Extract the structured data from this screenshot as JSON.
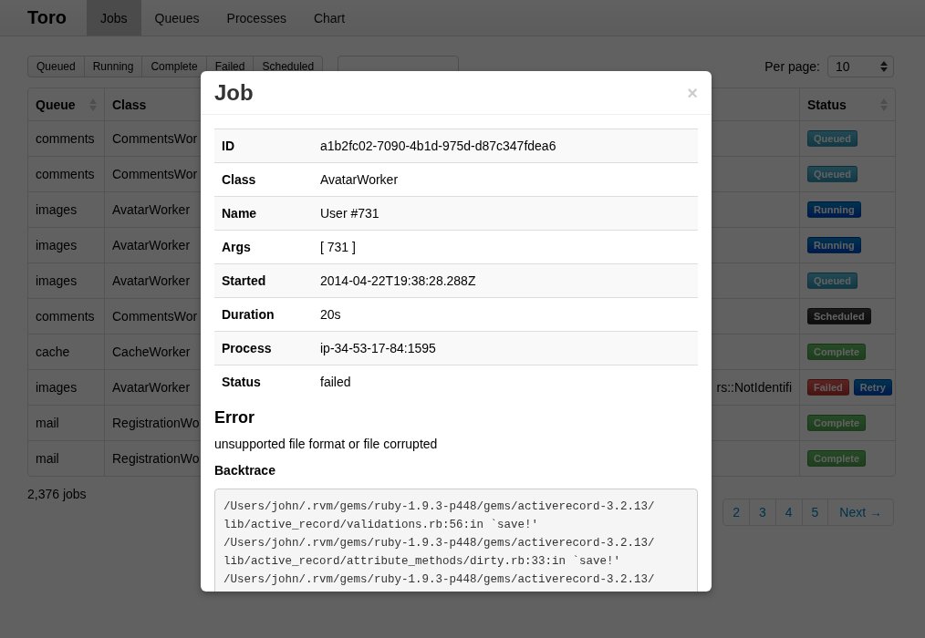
{
  "navbar": {
    "brand": "Toro",
    "tabs": [
      {
        "label": "Jobs",
        "selected": true
      },
      {
        "label": "Queues",
        "selected": false
      },
      {
        "label": "Processes",
        "selected": false
      },
      {
        "label": "Chart",
        "selected": false
      }
    ]
  },
  "filters": [
    "Queued",
    "Running",
    "Complete",
    "Failed",
    "Scheduled"
  ],
  "per_page": {
    "label": "Per page:",
    "value": "10"
  },
  "table": {
    "columns": [
      {
        "label": "Queue",
        "sortable": true
      },
      {
        "label": "Class"
      },
      {
        "label": "Status",
        "sortable": true
      }
    ],
    "rows": [
      {
        "queue": "comments",
        "class": "CommentsWor",
        "buttons": [
          {
            "label": "Queued",
            "kind": "queued"
          }
        ]
      },
      {
        "queue": "comments",
        "class": "CommentsWor",
        "buttons": [
          {
            "label": "Queued",
            "kind": "queued"
          }
        ]
      },
      {
        "queue": "images",
        "class": "AvatarWorker",
        "buttons": [
          {
            "label": "Running",
            "kind": "running"
          }
        ]
      },
      {
        "queue": "images",
        "class": "AvatarWorker",
        "buttons": [
          {
            "label": "Running",
            "kind": "running"
          }
        ]
      },
      {
        "queue": "images",
        "class": "AvatarWorker",
        "buttons": [
          {
            "label": "Queued",
            "kind": "queued"
          }
        ]
      },
      {
        "queue": "comments",
        "class": "CommentsWor",
        "buttons": [
          {
            "label": "Scheduled",
            "kind": "scheduled"
          }
        ]
      },
      {
        "queue": "cache",
        "class": "CacheWorker",
        "buttons": [
          {
            "label": "Complete",
            "kind": "complete"
          }
        ]
      },
      {
        "queue": "images",
        "class": "AvatarWorker",
        "error": "rs::NotIdentifi",
        "buttons": [
          {
            "label": "Failed",
            "kind": "failed"
          },
          {
            "label": "Retry",
            "kind": "retry"
          }
        ]
      },
      {
        "queue": "mail",
        "class": "RegistrationWo",
        "buttons": [
          {
            "label": "Complete",
            "kind": "complete"
          }
        ]
      },
      {
        "queue": "mail",
        "class": "RegistrationWo",
        "buttons": [
          {
            "label": "Complete",
            "kind": "complete"
          }
        ]
      }
    ]
  },
  "count": "2,376 jobs",
  "pagination": {
    "pages": [
      "2",
      "3",
      "4",
      "5"
    ],
    "next": "Next →"
  },
  "modal": {
    "title": "Job",
    "close": "×",
    "fields": [
      {
        "label": "ID",
        "value": "a1b2fc02-7090-4b1d-975d-d87c347fdea6"
      },
      {
        "label": "Class",
        "value": "AvatarWorker"
      },
      {
        "label": "Name",
        "value": "User #731"
      },
      {
        "label": "Args",
        "value": "[ 731 ]"
      },
      {
        "label": "Started",
        "value": "2014-04-22T19:38:28.288Z"
      },
      {
        "label": "Duration",
        "value": "20s"
      },
      {
        "label": "Process",
        "value": "ip-34-53-17-84:1595"
      },
      {
        "label": "Status",
        "value": "failed"
      }
    ],
    "error_heading": "Error",
    "error_message": "unsupported file format or file corrupted",
    "backtrace_heading": "Backtrace",
    "backtrace": [
      "/Users/john/.rvm/gems/ruby-1.9.3-p448/gems/activerecord-3.2.13/",
      "lib/active_record/validations.rb:56:in `save!'",
      "/Users/john/.rvm/gems/ruby-1.9.3-p448/gems/activerecord-3.2.13/",
      "lib/active_record/attribute_methods/dirty.rb:33:in `save!'",
      "/Users/john/.rvm/gems/ruby-1.9.3-p448/gems/activerecord-3.2.13/"
    ]
  }
}
